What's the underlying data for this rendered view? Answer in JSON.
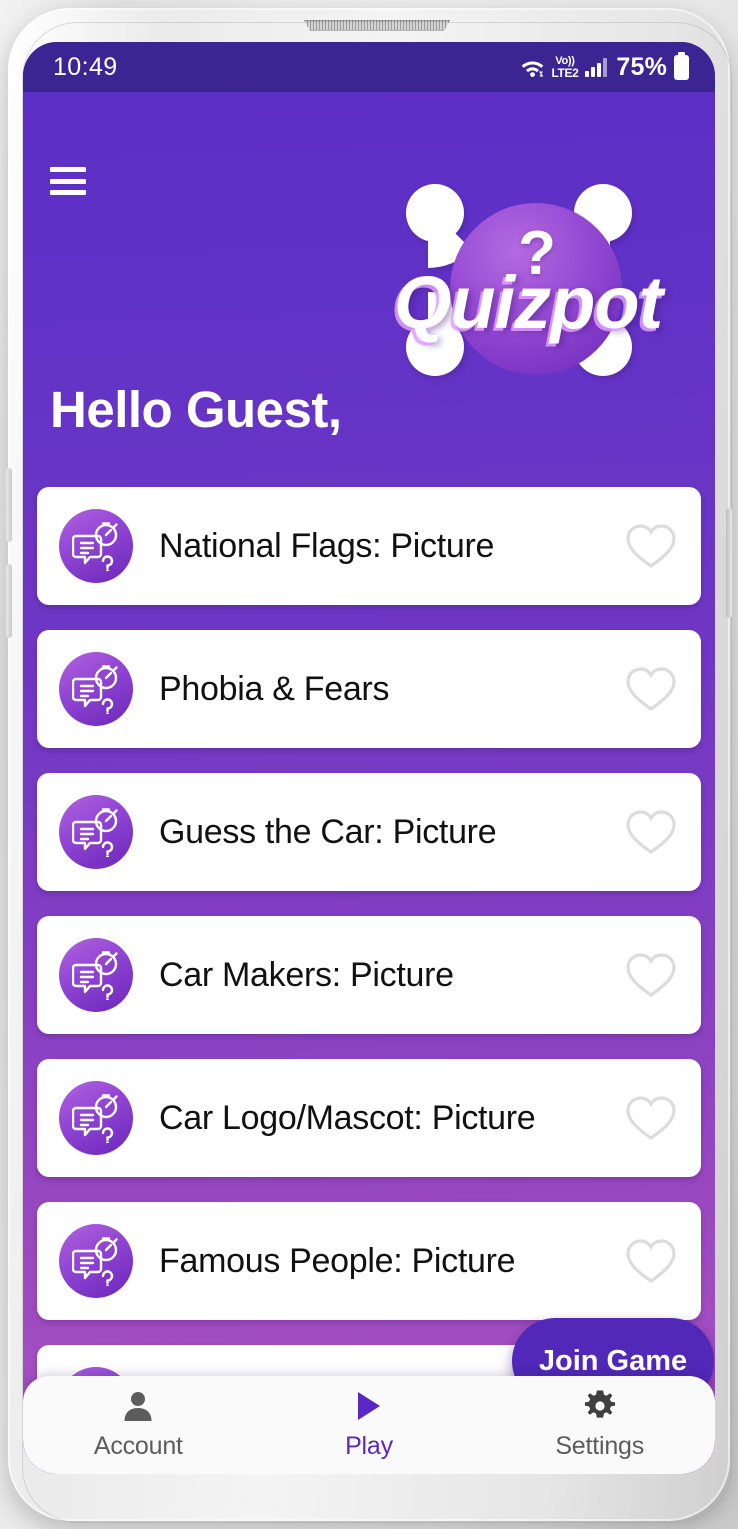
{
  "status_bar": {
    "time": "10:49",
    "wifi_icon": "wifi-icon",
    "volte_top": "Vo))",
    "volte_bottom": "LTE2",
    "signal_icon": "signal-bars-icon",
    "battery_percent": "75%",
    "battery_icon": "battery-icon"
  },
  "header": {
    "menu_icon": "hamburger-menu-icon",
    "logo_wordmark": "Quizpot",
    "logo_question_mark": "?",
    "greeting": "Hello Guest,"
  },
  "quiz_list": [
    {
      "title": "National Flags: Picture",
      "icon": "quiz-timer-icon",
      "favorite_icon": "heart-outline-icon",
      "favorited": false
    },
    {
      "title": "Phobia & Fears",
      "icon": "quiz-timer-icon",
      "favorite_icon": "heart-outline-icon",
      "favorited": false
    },
    {
      "title": "Guess the Car: Picture",
      "icon": "quiz-timer-icon",
      "favorite_icon": "heart-outline-icon",
      "favorited": false
    },
    {
      "title": "Car Makers: Picture",
      "icon": "quiz-timer-icon",
      "favorite_icon": "heart-outline-icon",
      "favorited": false
    },
    {
      "title": "Car Logo/Mascot: Picture",
      "icon": "quiz-timer-icon",
      "favorite_icon": "heart-outline-icon",
      "favorited": false
    },
    {
      "title": "Famous People: Picture",
      "icon": "quiz-timer-icon",
      "favorite_icon": "heart-outline-icon",
      "favorited": false
    },
    {
      "title": "",
      "icon": "quiz-timer-icon",
      "favorite_icon": "heart-outline-icon",
      "favorited": false
    }
  ],
  "join_game": {
    "label": "Join Game"
  },
  "bottom_nav": {
    "items": [
      {
        "label": "Account",
        "icon": "person-icon",
        "active": false
      },
      {
        "label": "Play",
        "icon": "play-triangle-icon",
        "active": true
      },
      {
        "label": "Settings",
        "icon": "gear-icon",
        "active": false
      }
    ]
  },
  "colors": {
    "status_bar": "#3b2592",
    "background_top": "#5b2ec6",
    "background_bottom": "#ab54bf",
    "card": "#ffffff",
    "accent": "#5b27c4",
    "fab": "#5128b8",
    "heart_outline": "#dcdcdc",
    "nav_inactive": "#5c5c5c"
  }
}
